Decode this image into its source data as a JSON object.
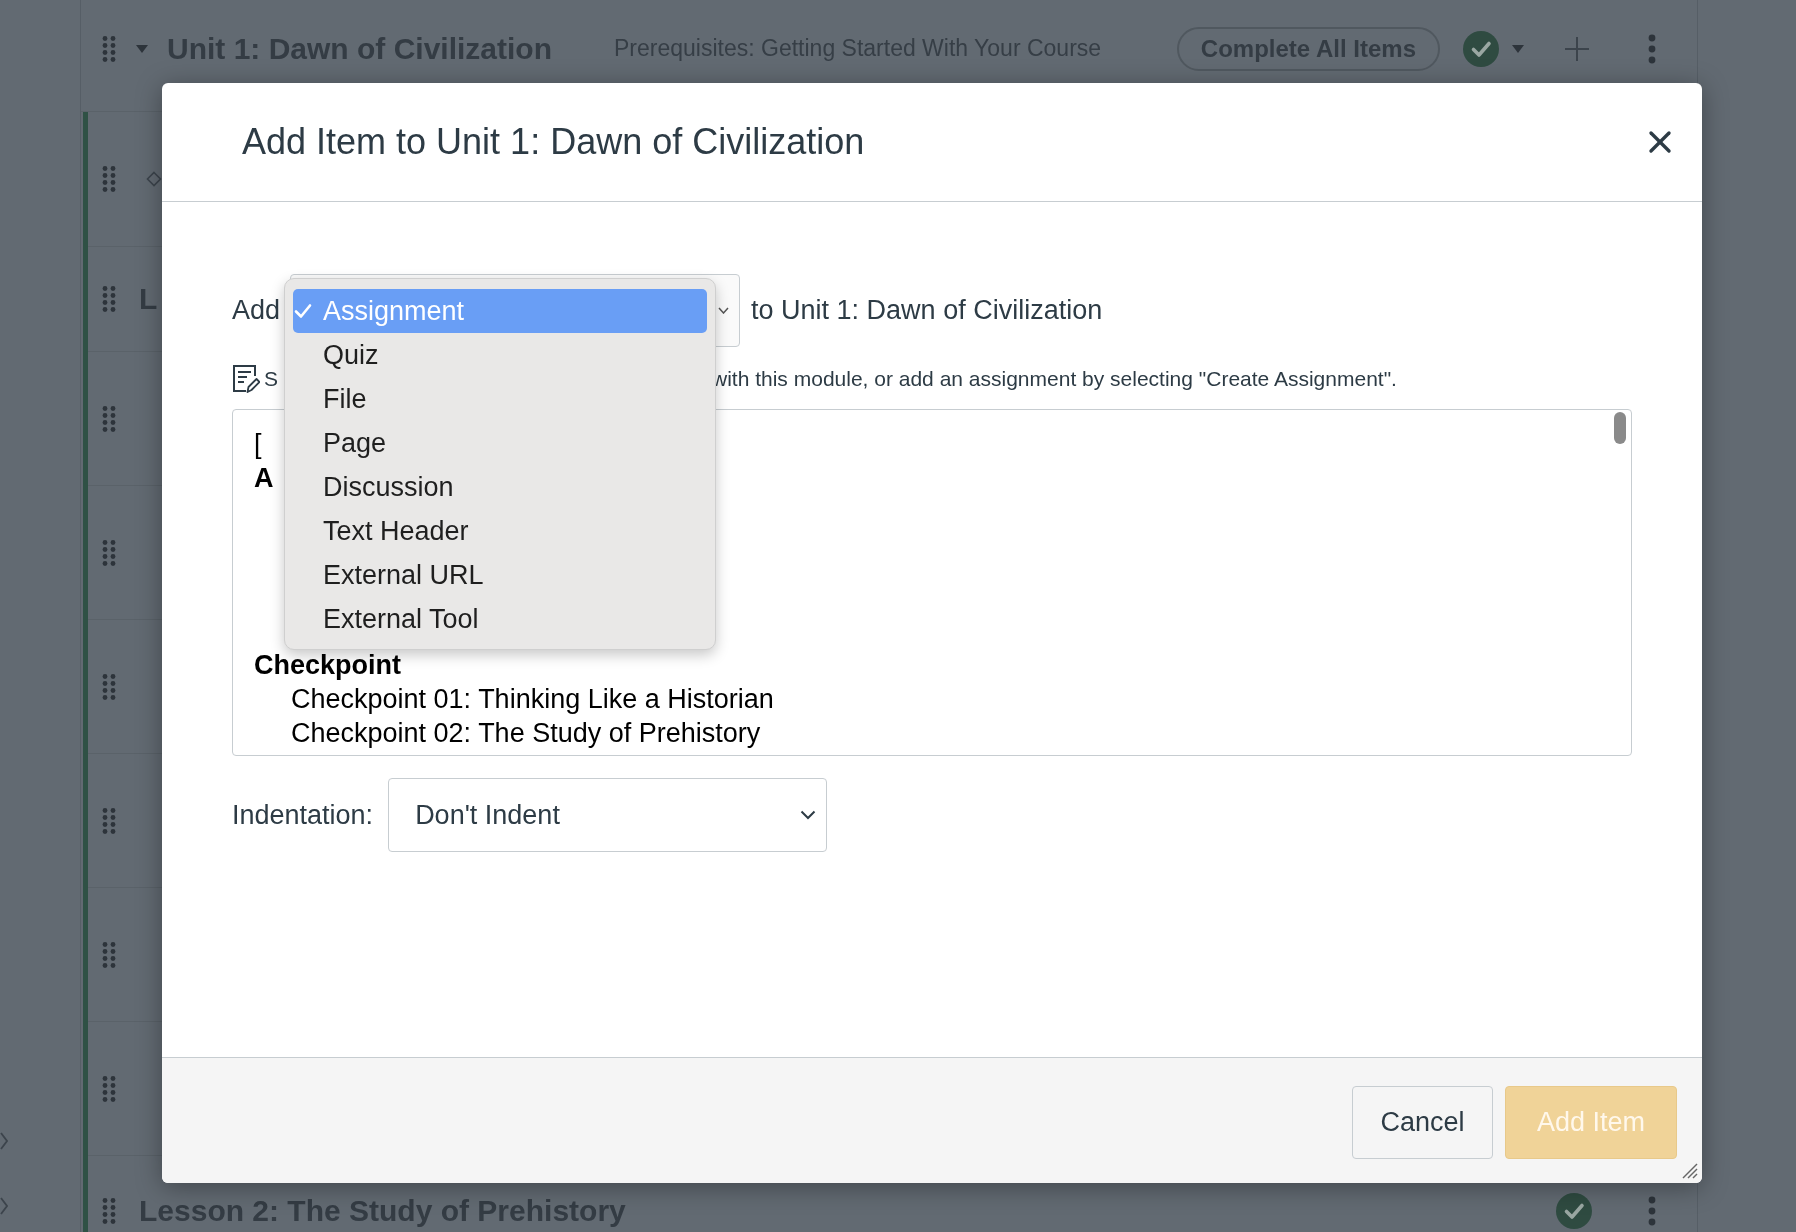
{
  "page": {
    "module": {
      "title": "Unit 1: Dawn of Civilization",
      "prerequisites": "Prerequisites: Getting Started With Your Course",
      "requirement": "Complete All Items",
      "completed": true
    },
    "items": [
      {
        "kind": "icon"
      },
      {
        "kind": "text",
        "title": "L"
      },
      {
        "kind": "blank"
      },
      {
        "kind": "blank"
      },
      {
        "kind": "blank"
      },
      {
        "kind": "blank"
      },
      {
        "kind": "blank"
      },
      {
        "kind": "blank"
      }
    ],
    "next_module": {
      "title": "Lesson 2: The Study of Prehistory",
      "completed": true
    }
  },
  "dialog": {
    "title": "Add Item to Unit 1: Dawn of Civilization",
    "add_label": "Add",
    "type_select": {
      "expanded": true,
      "options": [
        {
          "label": "Assignment",
          "selected": true
        },
        {
          "label": "Quiz",
          "selected": false
        },
        {
          "label": "File",
          "selected": false
        },
        {
          "label": "Page",
          "selected": false
        },
        {
          "label": "Discussion",
          "selected": false
        },
        {
          "label": "Text Header",
          "selected": false
        },
        {
          "label": "External URL",
          "selected": false
        },
        {
          "label": "External Tool",
          "selected": false
        }
      ]
    },
    "target": "to Unit 1: Dawn of Civilization",
    "hint": {
      "before": "S",
      "after": "with this module, or add an assignment by selecting \"Create Assignment\"."
    },
    "item_list": {
      "entries": [
        {
          "kind": "option",
          "text": "["
        },
        {
          "kind": "group",
          "text": "A"
        },
        {
          "kind": "group",
          "text": "Checkpoint",
          "children": [
            {
              "kind": "option",
              "text": "Checkpoint 01: Thinking Like a Historian"
            },
            {
              "kind": "option",
              "text": "Checkpoint 02: The Study of Prehistory"
            }
          ]
        }
      ]
    },
    "indentation": {
      "label": "Indentation:",
      "value": "Don't Indent"
    },
    "buttons": [
      {
        "label": "Cancel",
        "kind": "secondary",
        "disabled": false
      },
      {
        "label": "Add Item",
        "kind": "primary",
        "disabled": true
      }
    ]
  }
}
